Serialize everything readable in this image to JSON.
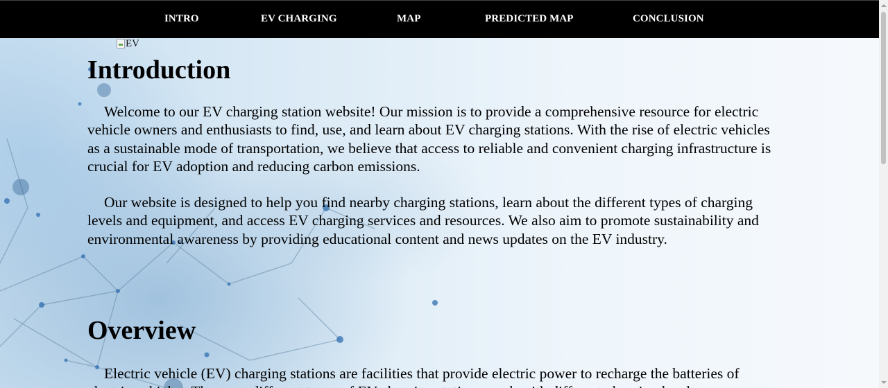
{
  "nav": {
    "items": [
      {
        "label": "INTRO"
      },
      {
        "label": "EV CHARGING"
      },
      {
        "label": "MAP"
      },
      {
        "label": "PREDICTED MAP"
      },
      {
        "label": "CONCLUSION"
      }
    ]
  },
  "hero_image": {
    "alt": "EV"
  },
  "intro": {
    "heading": "Introduction",
    "paragraphs": [
      "Welcome to our EV charging station website! Our mission is to provide a comprehensive resource for electric vehicle owners and enthusiasts to find, use, and learn about EV charging stations. With the rise of electric vehicles as a sustainable mode of transportation, we believe that access to reliable and convenient charging infrastructure is crucial for EV adoption and reducing carbon emissions.",
      "Our website is designed to help you find nearby charging stations, learn about the different types of charging levels and equipment, and access EV charging services and resources. We also aim to promote sustainability and environmental awareness by providing educational content and news updates on the EV industry."
    ]
  },
  "overview": {
    "heading": "Overview",
    "paragraph": "Electric vehicle (EV) charging stations are facilities that provide electric power to recharge the batteries of electric vehicles. There are different types of EV charging stations, each with different charging levels"
  },
  "theme": {
    "nav_bg": "#000000",
    "nav_text": "#ffffff",
    "text": "#000000",
    "background_tint": "#dcebf6"
  },
  "icons": {
    "broken_image": "broken-image-icon",
    "scroll_up": "arrow-up-icon",
    "scroll_down": "arrow-down-icon"
  }
}
